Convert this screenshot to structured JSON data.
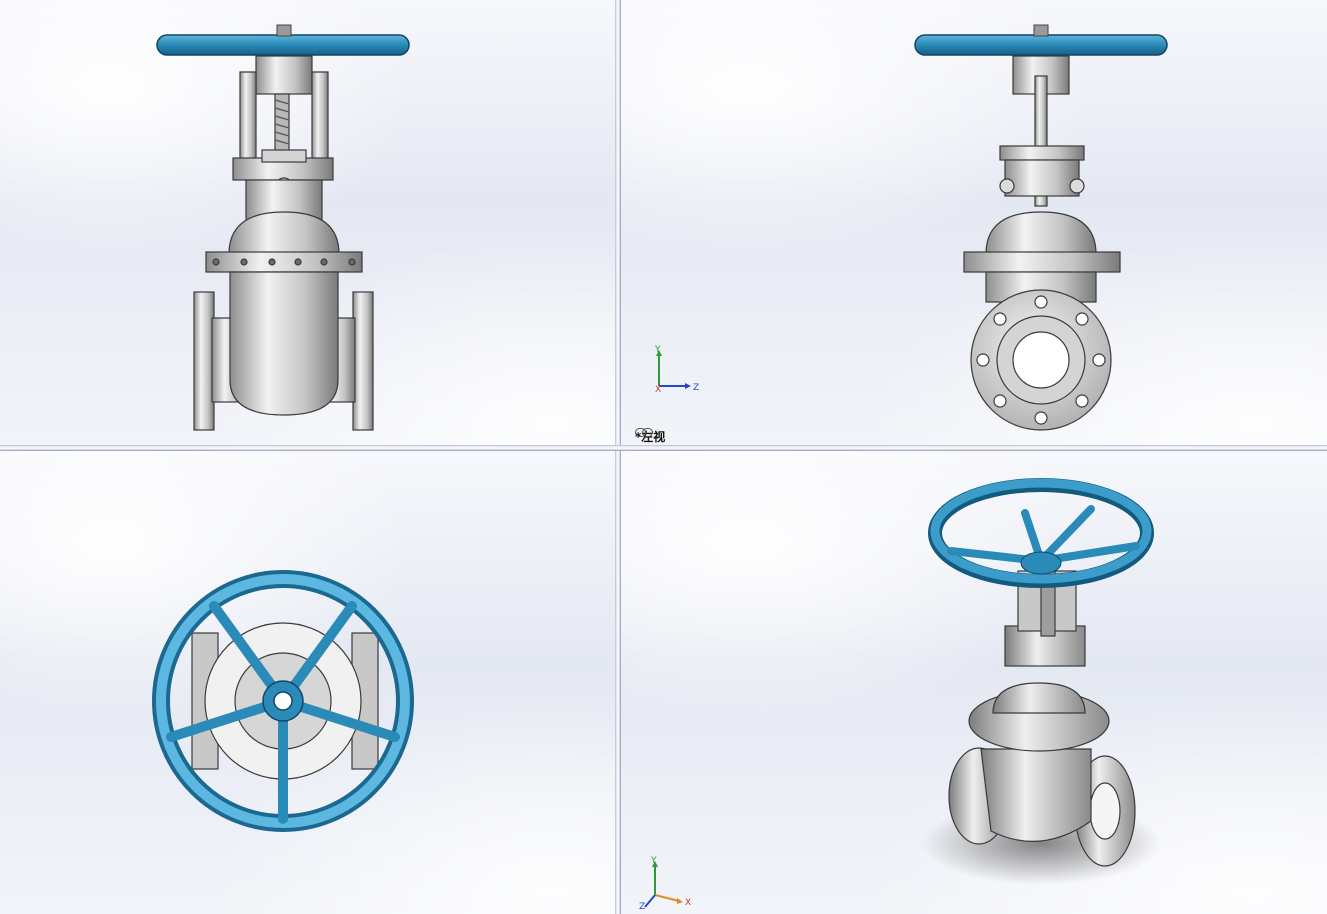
{
  "viewports": {
    "front": {
      "name": "front"
    },
    "left": {
      "name": "left",
      "label": "*左视"
    },
    "top": {
      "name": "top"
    },
    "iso": {
      "name": "isometric"
    }
  },
  "triad": {
    "x": "X",
    "y": "Y",
    "z": "Z"
  },
  "colors": {
    "handwheel": "#2b8ab5",
    "handwheel_dark": "#135a7f",
    "steel": "#c9c9c9",
    "steel_dark": "#5e5e5e",
    "axis_x": "#d0342c",
    "axis_y": "#2f9a3a",
    "axis_z": "#2449c8"
  }
}
